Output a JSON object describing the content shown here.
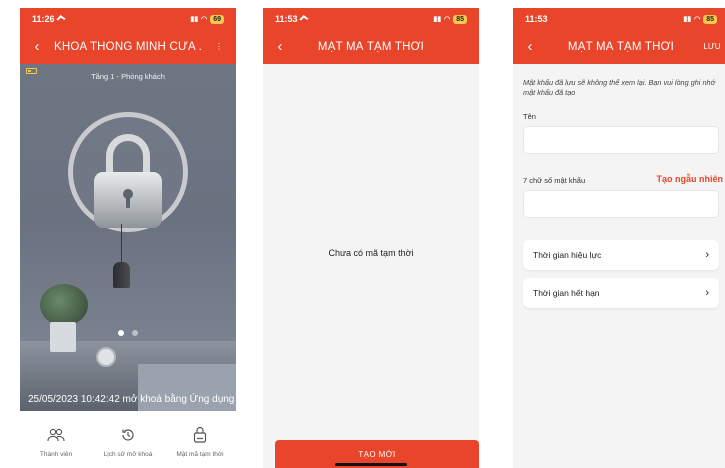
{
  "colors": {
    "accent": "#e8452b",
    "screen_bg": "#f4f4f4"
  },
  "phone1": {
    "status": {
      "time": "11:26",
      "battery": "69"
    },
    "title": "KHÓA THÔNG MINH CỬA ...",
    "back_icon": "chevron-left-icon",
    "menu_icon": "more-vertical-icon",
    "room": "Tầng 1 - Phòng khách",
    "lock_state_icon": "lock-icon",
    "last_event": "25/05/2023 10:42:42 mở khoá bằng Ứng dụng",
    "carousel_active_index": 1,
    "carousel_total": 2,
    "tabs": [
      {
        "label": "Thành viên",
        "icon": "users-icon"
      },
      {
        "label": "Lịch sử mở khoá",
        "icon": "history-icon"
      },
      {
        "label": "Mật mã tạm thời",
        "icon": "temp-password-icon"
      }
    ]
  },
  "phone2": {
    "status": {
      "time": "11:53",
      "battery": "85"
    },
    "title": "MẬT MÃ TẠM THỜI",
    "empty_message": "Chưa có mã tạm thời",
    "create_button": "TẠO MỚI"
  },
  "phone3": {
    "status": {
      "time": "11:53",
      "battery": "85"
    },
    "title": "MẬT MÃ TẠM THỜI",
    "save_label": "LƯU",
    "notice": "Mật khẩu đã lưu sẽ không thể xem lại. Bạn vui lòng ghi nhớ mật khẩu đã tạo",
    "name_label": "Tên",
    "name_value": "",
    "password_label": "7 chữ số mật khẩu",
    "password_value": "",
    "random_link": "Tạo ngẫu nhiên",
    "valid_time_label": "Thời gian hiệu lực",
    "expire_time_label": "Thời gian hết hạn"
  }
}
